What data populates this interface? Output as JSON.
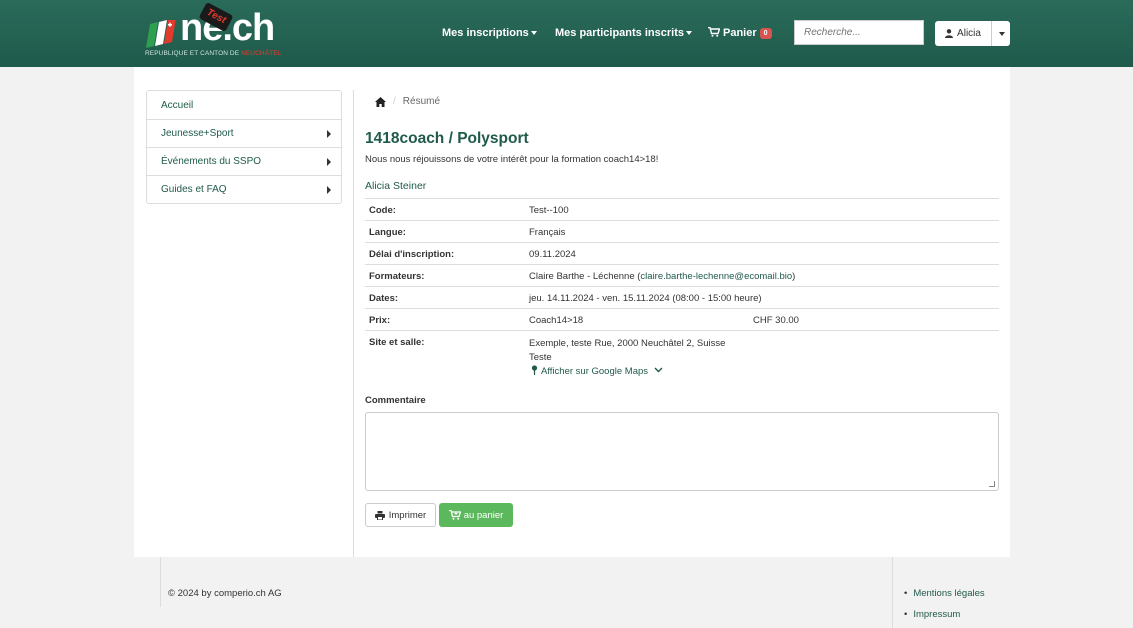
{
  "header": {
    "logo_text": "ne.ch",
    "logo_badge": "Test",
    "logo_subtitle_prefix": "REPUBLIQUE ET CANTON DE ",
    "logo_subtitle_highlight": "NEUCHÂTEL",
    "nav": {
      "inscriptions": "Mes inscriptions",
      "participants": "Mes participants inscrits",
      "cart": "Panier",
      "cart_count": "0"
    },
    "search_placeholder": "Recherche...",
    "user_name": "Alicia"
  },
  "sidebar": {
    "items": [
      {
        "label": "Accueil"
      },
      {
        "label": "Jeunesse+Sport"
      },
      {
        "label": "Événements du SSPO"
      },
      {
        "label": "Guides et FAQ"
      }
    ]
  },
  "breadcrumb": {
    "current": "Résumé"
  },
  "main": {
    "title": "1418coach / Polysport",
    "subtitle": "Nous nous réjouissons de votre intérêt pour la formation coach14>18!",
    "person": "Alicia Steiner",
    "rows": {
      "code": {
        "label": "Code:",
        "value": "Test--100"
      },
      "langue": {
        "label": "Langue:",
        "value": "Français"
      },
      "delai": {
        "label": "Délai d'inscription:",
        "value": "09.11.2024"
      },
      "formateurs": {
        "label": "Formateurs:",
        "value_prefix": "Claire Barthe - Léchenne (",
        "email": "claire.barthe-lechenne@ecomail.bio",
        "value_suffix": ")"
      },
      "dates": {
        "label": "Dates:",
        "value": "jeu. 14.11.2024 - ven. 15.11.2024 (08:00 - 15:00 heure)"
      },
      "prix": {
        "label": "Prix:",
        "value": "Coach14>18",
        "amount": "CHF 30.00"
      },
      "site": {
        "label": "Site et salle:",
        "line1": "Exemple, teste Rue, 2000 Neuchâtel 2, Suisse",
        "line2": "Teste",
        "maps_link": "Afficher sur Google Maps"
      }
    },
    "comment_label": "Commentaire",
    "print_button": "Imprimer",
    "cart_button": "au panier"
  },
  "footer": {
    "copyright": "© 2024 by comperio.ch AG",
    "links": [
      "Mentions légales",
      "Impressum"
    ]
  },
  "colors": {
    "header_bg": "#1f5a4b",
    "accent": "#1f5a4b",
    "cart_badge": "#d9534f",
    "cart_button": "#5cb85c"
  }
}
